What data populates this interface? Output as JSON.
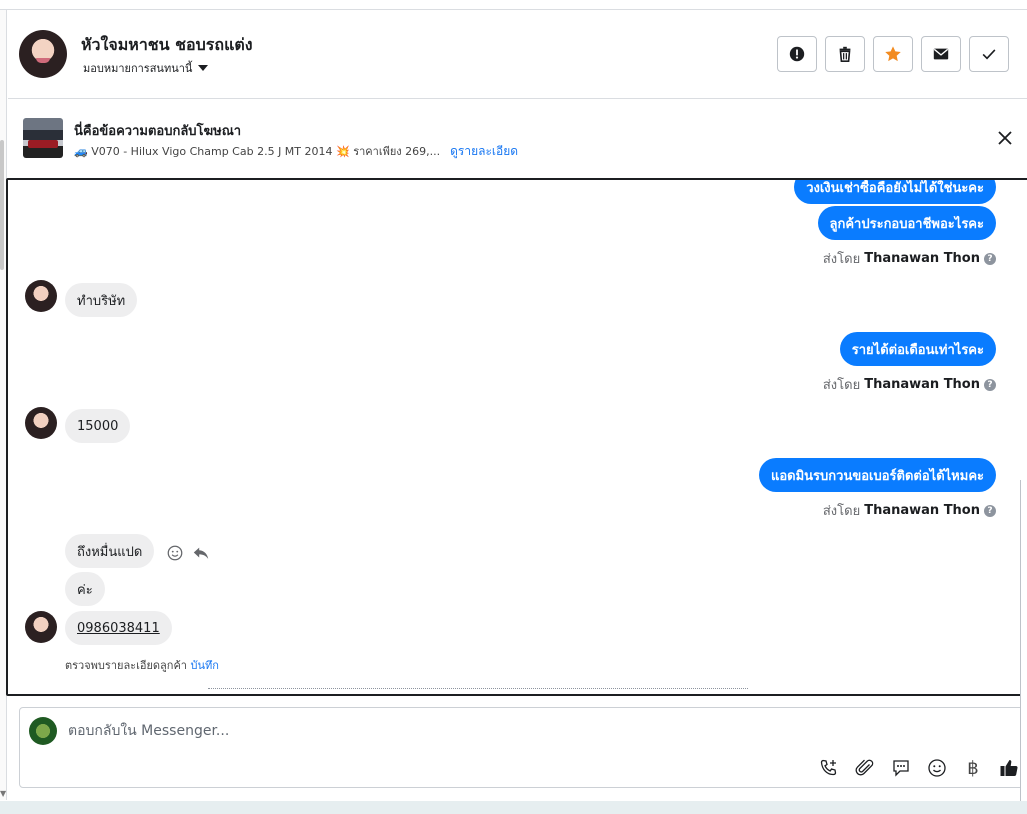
{
  "header": {
    "contact_name": "หัวใจมหาชน ชอบรถแต่ง",
    "assign_label": "มอบหมายการสนทนานี้",
    "actions": [
      {
        "name": "mark-spam-button",
        "icon": "exclamation-icon"
      },
      {
        "name": "delete-button",
        "icon": "trash-icon"
      },
      {
        "name": "star-button",
        "icon": "star-icon"
      },
      {
        "name": "mark-unread-button",
        "icon": "envelope-icon"
      },
      {
        "name": "mark-done-button",
        "icon": "check-icon"
      }
    ],
    "star_color": "#f28b20"
  },
  "ad_banner": {
    "title": "นี่คือข้อความตอบกลับโฆษณา",
    "subtitle": "🚙 V070 - Hilux Vigo Champ Cab 2.5 J MT 2014 💥 ราคาเพียง 269,...",
    "details_link": "ดูรายละเอียด"
  },
  "messages": {
    "out1_partial": "วงเงินเช่าซื้อคือยังไม่ได้ใช่นะคะ",
    "out2": "ลูกค้าประกอบอาชีพอะไรคะ",
    "sent_by_prefix": "ส่งโดย",
    "agent_name": "Thanawan Thon",
    "in1": "ทำบริษัท",
    "out3": "รายได้ต่อเดือนเท่าไรคะ",
    "in2": "15000",
    "out4": "แอดมินรบกวนขอเบอร์ติดต่อได้ไหมคะ",
    "in3": "ถึงหมื่นแปด",
    "in4": "ค่ะ",
    "in5_phone": "0986038411",
    "detected_text": "ตรวจพบรายละเอียดลูกค้า",
    "detected_save": "บันทึก"
  },
  "composer": {
    "placeholder": "ตอบกลับใน Messenger...",
    "icons": [
      "add-call-icon",
      "attach-icon",
      "saved-reply-icon",
      "emoji-icon",
      "baht-icon",
      "like-icon"
    ],
    "baht_symbol": "฿"
  },
  "colors": {
    "accent": "#0a7cff",
    "link": "#1877f2",
    "incoming_bubble": "#eeeeef"
  }
}
